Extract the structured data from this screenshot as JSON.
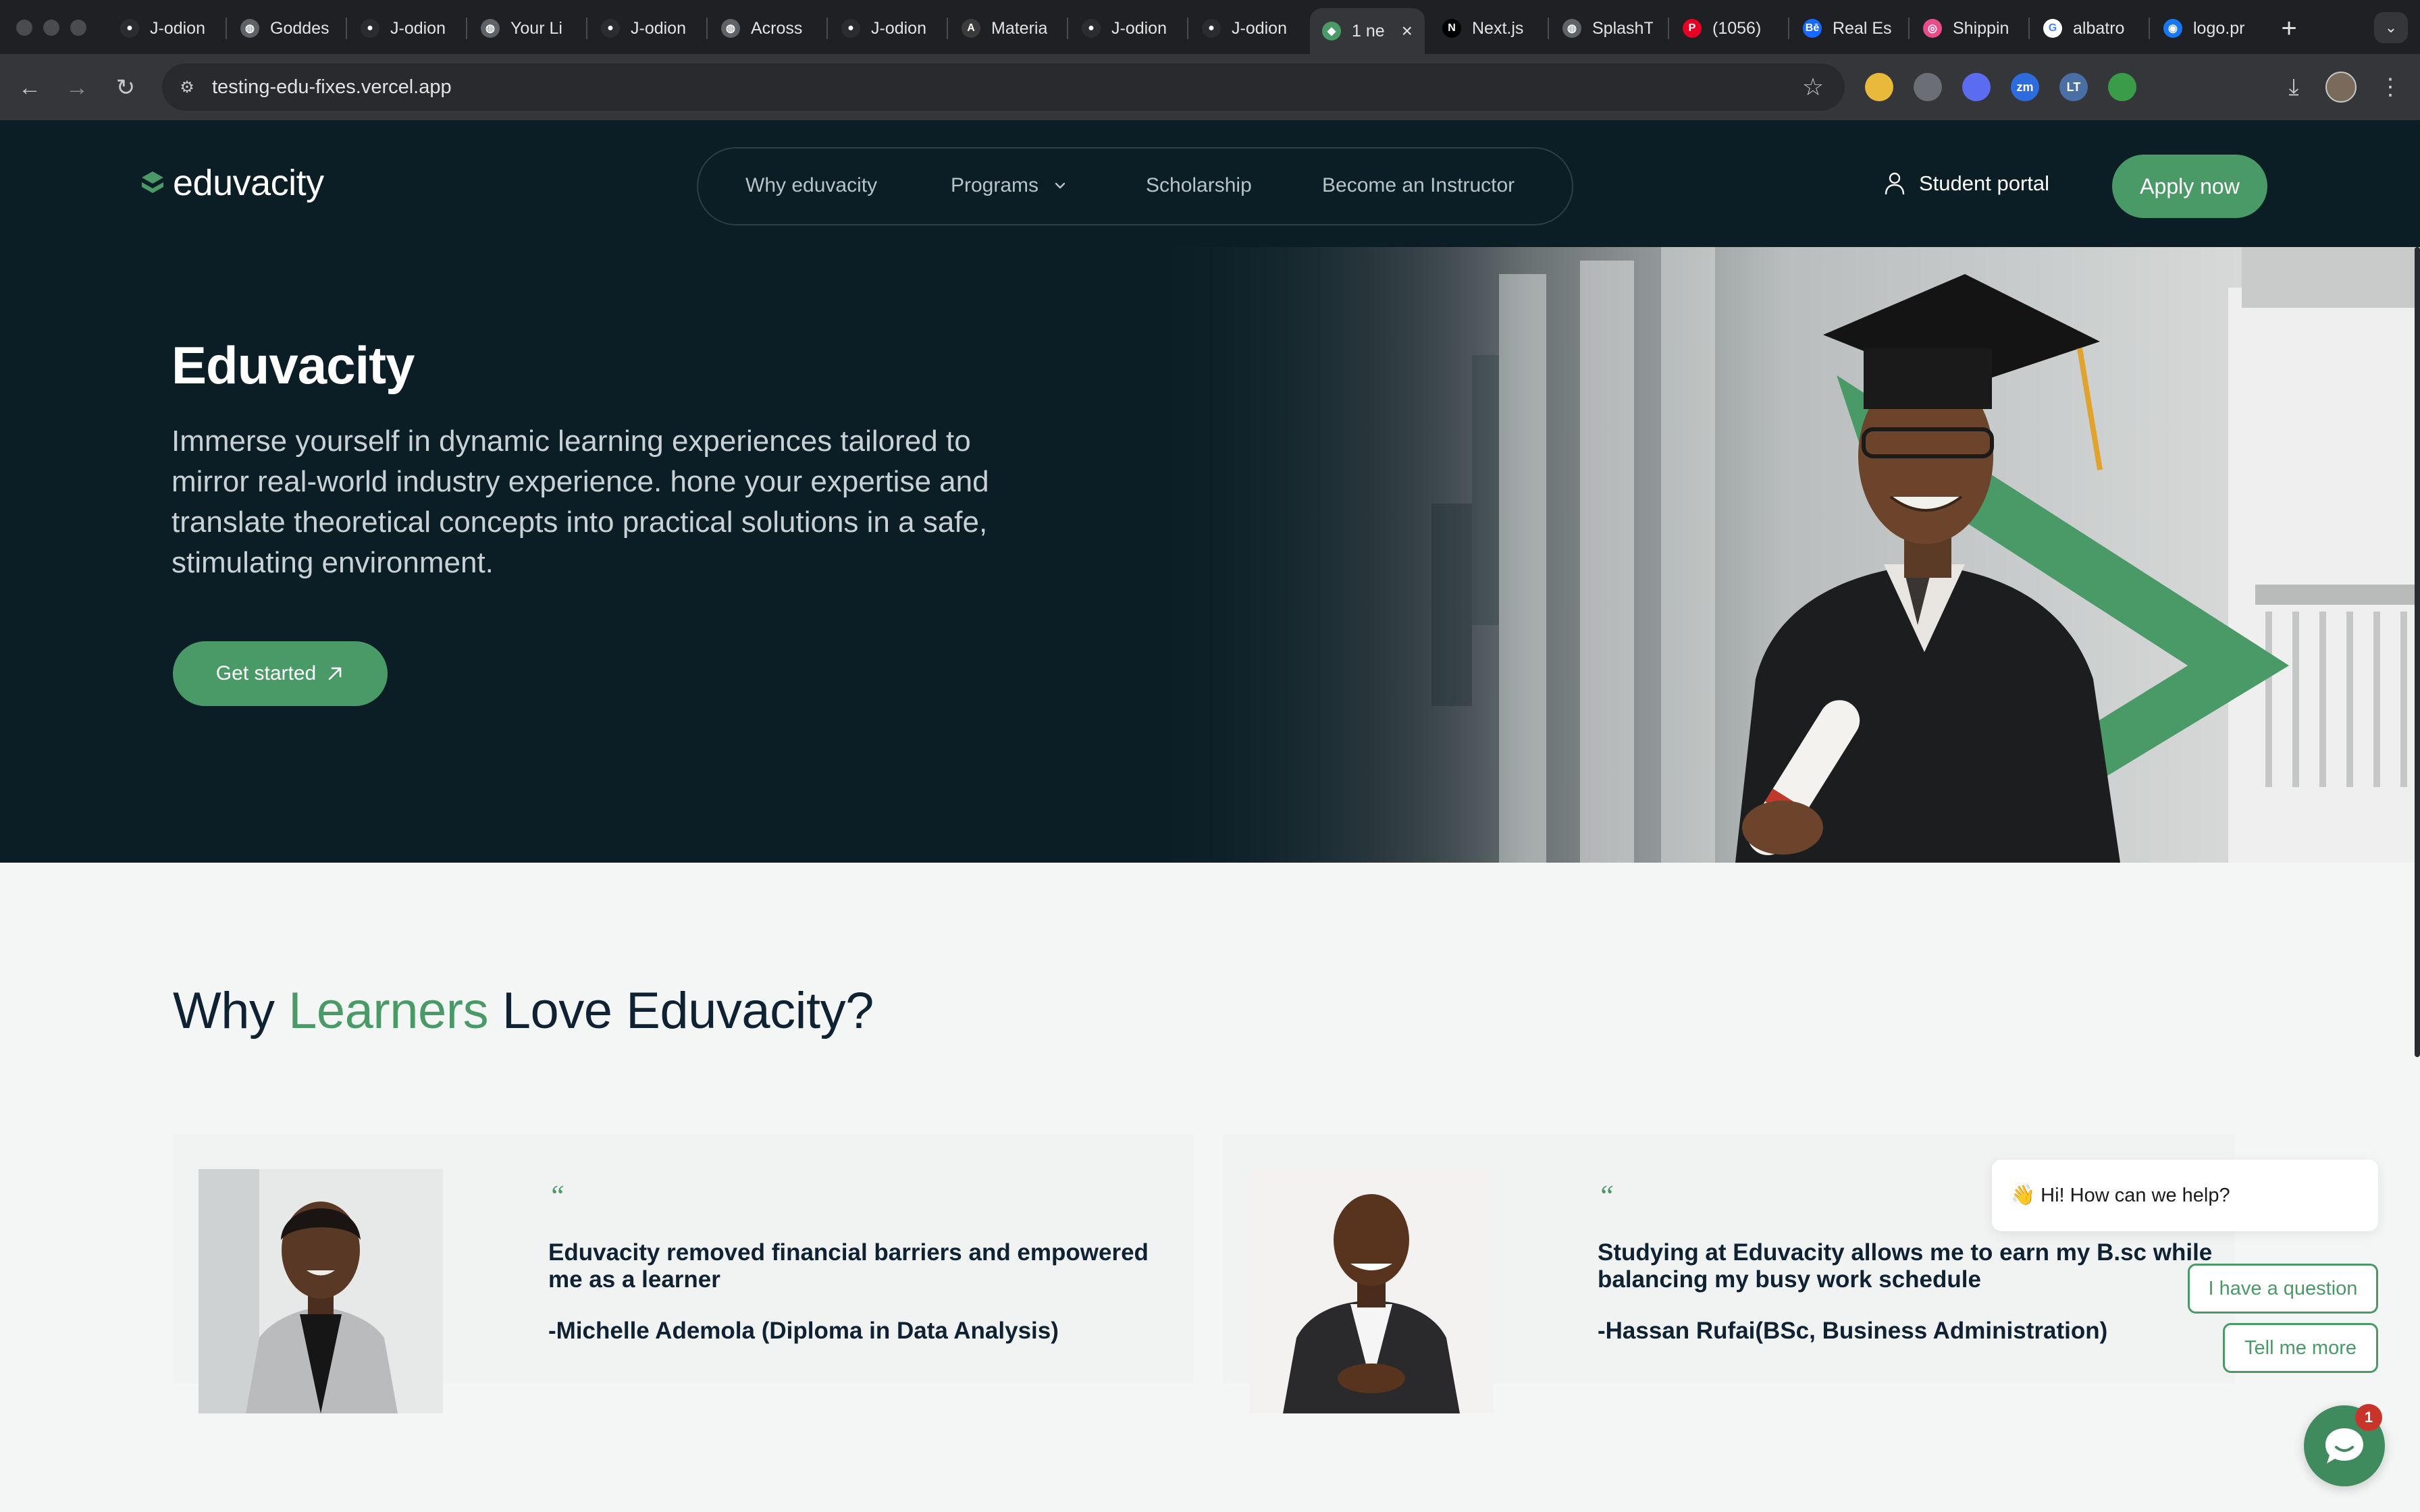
{
  "browser": {
    "tabs": [
      {
        "title": "J-odion",
        "icon": "github-icon"
      },
      {
        "title": "Goddes",
        "icon": "globe-icon"
      },
      {
        "title": "J-odion",
        "icon": "github-icon"
      },
      {
        "title": "Your Li",
        "icon": "globe-icon"
      },
      {
        "title": "J-odion",
        "icon": "github-icon"
      },
      {
        "title": "Across",
        "icon": "globe-icon"
      },
      {
        "title": "J-odion",
        "icon": "github-icon"
      },
      {
        "title": "Materia",
        "icon": "material-icon"
      },
      {
        "title": "J-odion",
        "icon": "github-icon"
      },
      {
        "title": "J-odion",
        "icon": "github-icon"
      },
      {
        "title": "1 ne",
        "icon": "eduvacity-icon",
        "active": true
      },
      {
        "title": "Next.js",
        "icon": "nextjs-icon"
      },
      {
        "title": "SplashT",
        "icon": "globe-icon"
      },
      {
        "title": "(1056)",
        "icon": "pinterest-icon"
      },
      {
        "title": "Real Es",
        "icon": "behance-icon"
      },
      {
        "title": "Shippin",
        "icon": "dribbble-icon"
      },
      {
        "title": "albatro",
        "icon": "google-icon"
      },
      {
        "title": "logo.pr",
        "icon": "messenger-icon"
      }
    ],
    "url": "testing-edu-fixes.vercel.app",
    "extensions": [
      {
        "name": "color-picker-icon",
        "color": "#e8b93b",
        "glyph": ""
      },
      {
        "name": "camera-icon",
        "color": "#6b6f75",
        "glyph": ""
      },
      {
        "name": "gear-extension-icon",
        "color": "#5b6cf0",
        "glyph": ""
      },
      {
        "name": "zoom-extension-icon",
        "color": "#2d6cdf",
        "glyph": "zm"
      },
      {
        "name": "lt-extension-icon",
        "color": "#4a6fa5",
        "glyph": "LT"
      },
      {
        "name": "android-extension-icon",
        "color": "#3a9b49",
        "glyph": ""
      },
      {
        "name": "eyedropper-icon",
        "color": "#35363a",
        "glyph": ""
      },
      {
        "name": "puzzle-icon",
        "color": "#35363a",
        "glyph": ""
      }
    ]
  },
  "site": {
    "logo_text": "eduvacity",
    "nav": {
      "why": "Why eduvacity",
      "programs": "Programs",
      "scholarship": "Scholarship",
      "instructor": "Become an Instructor"
    },
    "student_portal": "Student portal",
    "apply": "Apply now"
  },
  "hero": {
    "title": "Eduvacity",
    "description": "Immerse yourself in dynamic learning experiences tailored to mirror real-world industry experience. hone your expertise and translate theoretical concepts into practical solutions in a safe, stimulating environment.",
    "cta": "Get started"
  },
  "testimonials": {
    "heading_pre": "Why ",
    "heading_accent": "Learners",
    "heading_post": " Love Eduvacity?",
    "items": [
      {
        "quote_mark": "“",
        "quote": "Eduvacity removed financial barriers and empowered me as a learner",
        "author": "-Michelle Ademola (Diploma in Data Analysis)"
      },
      {
        "quote_mark": "“",
        "quote": "Studying at Eduvacity allows me to earn my B.sc while balancing my busy work schedule",
        "author": "-Hassan Rufai(BSc, Business Administration)"
      }
    ]
  },
  "chat": {
    "greeting": "👋 Hi! How can we help?",
    "option_1": "I have a question",
    "option_2": "Tell me more",
    "badge": "1"
  },
  "colors": {
    "brand_green": "#4a9a68",
    "header_bg": "#0b1e26",
    "heading_navy": "#0f2233"
  }
}
